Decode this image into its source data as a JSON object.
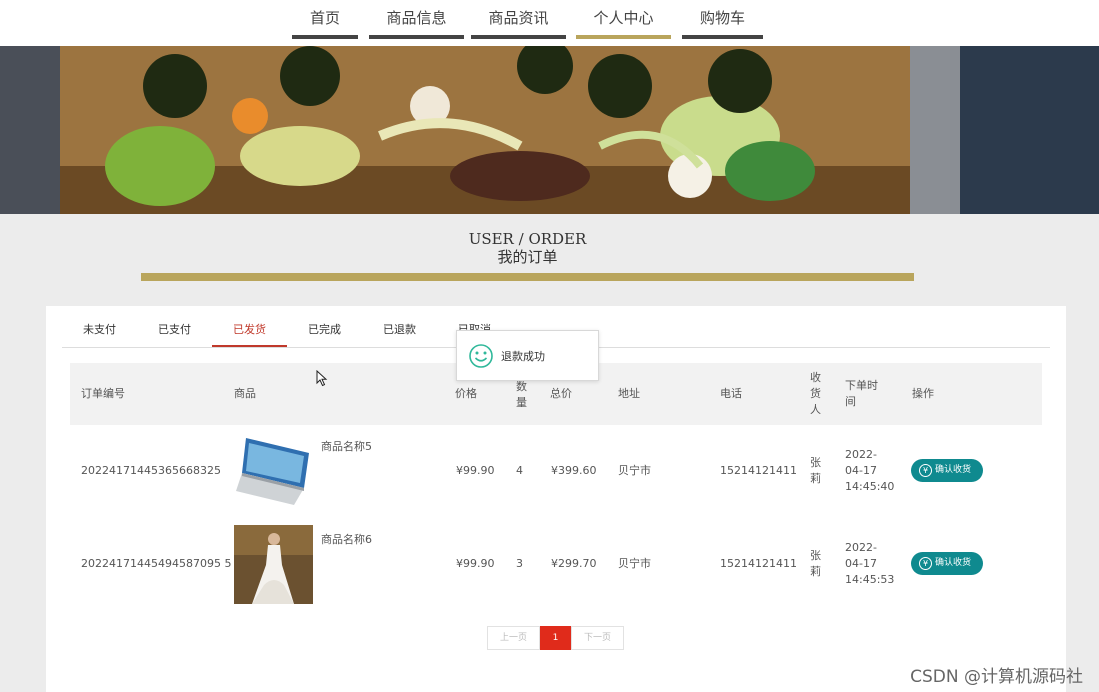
{
  "nav": {
    "items": [
      {
        "label": "首页"
      },
      {
        "label": "商品信息"
      },
      {
        "label": "商品资讯"
      },
      {
        "label": "个人中心"
      },
      {
        "label": "购物车"
      }
    ],
    "active_index": 3
  },
  "section": {
    "title_en": "USER / ORDER",
    "title_cn": "我的订单"
  },
  "tabs": [
    {
      "label": "未支付"
    },
    {
      "label": "已支付"
    },
    {
      "label": "已发货"
    },
    {
      "label": "已完成"
    },
    {
      "label": "已退款"
    },
    {
      "label": "已取消"
    }
  ],
  "active_tab_index": 2,
  "table": {
    "headers": {
      "order_no": "订单编号",
      "product": "商品",
      "price": "价格",
      "qty": "数量",
      "total": "总价",
      "address": "地址",
      "phone": "电话",
      "receiver": "收货人",
      "time": "下单时间",
      "action": "操作"
    },
    "rows": [
      {
        "order_no": "20224171445365668325",
        "product_name": "商品名称5",
        "price": "¥99.90",
        "qty": "4",
        "total": "¥399.60",
        "address": "贝宁市",
        "phone": "15214121411",
        "receiver": "张莉",
        "time": "2022-04-17 14:45:40",
        "action": "确认收货"
      },
      {
        "order_no": "20224171445494587095 5",
        "product_name": "商品名称6",
        "price": "¥99.90",
        "qty": "3",
        "total": "¥299.70",
        "address": "贝宁市",
        "phone": "15214121411",
        "receiver": "张莉",
        "time": "2022-04-17 14:45:53",
        "action": "确认收货"
      }
    ]
  },
  "pager": {
    "prev": "上一页",
    "current": "1",
    "next": "下一页"
  },
  "toast": {
    "message": "退款成功"
  },
  "watermark": "CSDN @计算机源码社",
  "colors": {
    "accent_gold": "#b9a55c",
    "action_teal": "#0f8a8f",
    "active_red": "#c0392b",
    "pager_red": "#e02b1b"
  }
}
